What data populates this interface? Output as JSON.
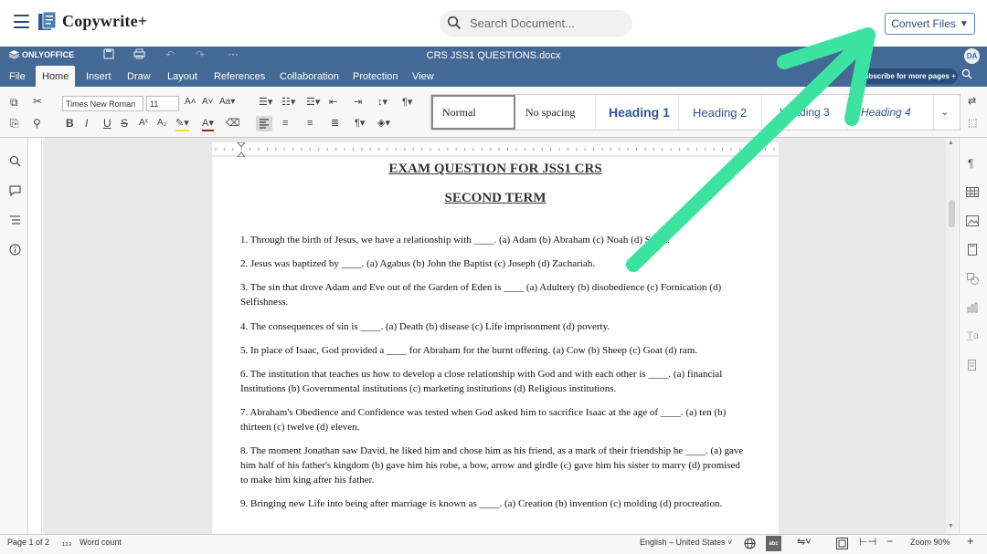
{
  "site": {
    "brand": "Copywrite+",
    "search_placeholder": "Search Document...",
    "convert_label": "Convert Files",
    "convert_caret": "▼"
  },
  "editor": {
    "app_name": "ONLYOFFICE",
    "doc_title": "CRS JSS1 QUESTIONS.docx",
    "user_initials": "DA",
    "tabs": [
      "File",
      "Home",
      "Insert",
      "Draw",
      "Layout",
      "References",
      "Collaboration",
      "Protection",
      "View"
    ],
    "active_tab": "Home",
    "subscribe_label": "Subscribe for more pages +"
  },
  "toolbar": {
    "font_name": "Times New Roman",
    "font_size": "11",
    "styles": [
      "Normal",
      "No spacing",
      "Heading 1",
      "Heading 2",
      "Heading 3",
      "Heading 4"
    ],
    "selected_style": "Normal"
  },
  "document": {
    "title": "EXAM QUESTION FOR JSS1 CRS",
    "subtitle": "SECOND TERM",
    "questions": [
      "1. Through the birth of Jesus, we have a relationship with ____. (a) Adam (b) Abraham (c) Noah (d) Spirit.",
      "2. Jesus was baptized by ____. (a) Agabus (b) John the Baptist (c) Joseph (d) Zachariah.",
      "3. The sin that drove Adam and Eve out of the Garden of Eden is ____ (a) Adultery (b) disobedience (c) Fornication (d) Selfishness.",
      "4. The consequences of sin is ____. (a) Death (b) disease (c) Life imprisonment (d) poverty.",
      "5. In place of Isaac, God provided a ____ for Abraham for the burnt offering. (a) Cow (b) Sheep (c) Goat (d) ram.",
      "6. The institution that teaches us how to develop a close relationship with God and with each other is ____. (a) financial Institutions (b) Governmental institutions (c) marketing institutions (d) Religious institutions.",
      "7. Abraham's Obedience and Confidence was tested when God asked him to sacrifice Isaac at the age of ____. (a) ten (b) thirteen (c) twelve (d) eleven.",
      "8. The moment Jonathan saw David, he liked him and chose him as his friend, as a mark of their friendship he ____. (a) gave him half of his father's kingdom (b) gave him his robe, a bow, arrow and girdle (c) gave him his sister to marry (d) promised to make him king after his father.",
      "9. Bringing new Life into being after marriage is known as ____. (a) Creation (b) invention (c) molding (d) procreation."
    ]
  },
  "status": {
    "page": "Page 1 of 2",
    "word_count": "Word count",
    "language": "English – United States",
    "zoom": "Zoom 90%"
  },
  "annotation": {
    "arrow_color": "#3ce3a0"
  }
}
